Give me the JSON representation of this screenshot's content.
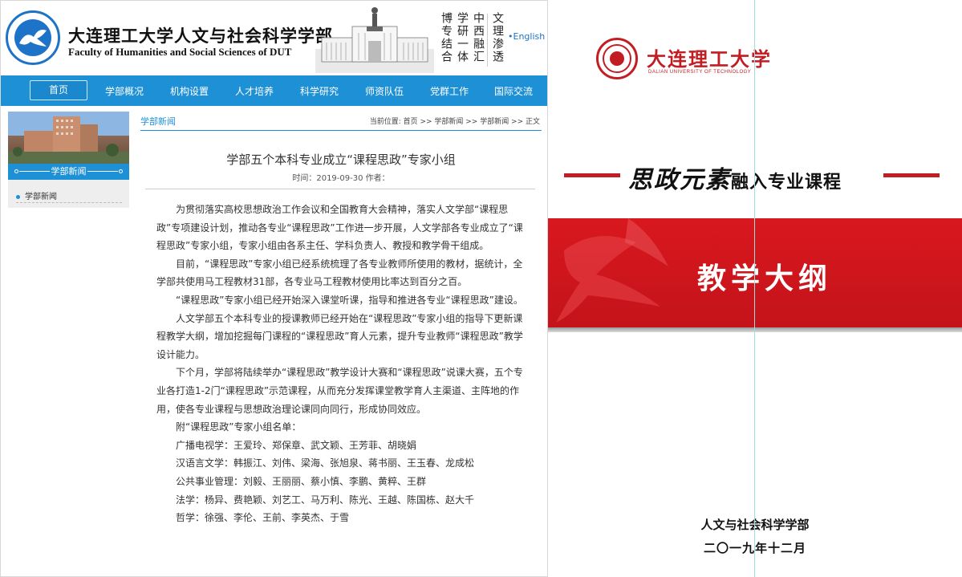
{
  "header": {
    "title_cn": "大连理工大学人文与社会科学学部",
    "title_en": "Faculty of Humanities and Social Sciences of DUT",
    "motto_columns": [
      "博专结合",
      "学研一体",
      "中西融汇",
      "文理渗透"
    ],
    "english_link": "•English"
  },
  "nav": {
    "items": [
      "首页",
      "学部概况",
      "机构设置",
      "人才培养",
      "科学研究",
      "师资队伍",
      "党群工作",
      "国际交流"
    ]
  },
  "sidebar": {
    "title": "学部新闻",
    "items": [
      "学部新闻"
    ]
  },
  "content": {
    "section": "学部新闻",
    "breadcrumb": "当前位置:  首页  >> 学部新闻  >>  学部新闻  >>  正文"
  },
  "article": {
    "title": "学部五个本科专业成立“课程思政”专家小组",
    "meta": "时间：2019-09-30 作者：",
    "paragraphs": [
      "为贯彻落实高校思想政治工作会议和全国教育大会精神，落实人文学部“课程思政”专项建设计划，推动各专业“课程思政”工作进一步开展，人文学部各专业成立了“课程思政”专家小组，专家小组由各系主任、学科负责人、教授和教学骨干组成。",
      "目前，“课程思政”专家小组已经系统梳理了各专业教师所使用的教材，据统计，全学部共使用马工程教材31部，各专业马工程教材使用比率达到百分之百。",
      "“课程思政”专家小组已经开始深入课堂听课，指导和推进各专业“课程思政”建设。",
      "人文学部五个本科专业的授课教师已经开始在“课程思政”专家小组的指导下更新课程教学大纲，增加挖掘每门课程的“课程思政”育人元素，提升专业教师“课程思政”教学设计能力。",
      "下个月，学部将陆续举办“课程思政”教学设计大赛和“课程思政”说课大赛，五个专业各打造1-2门“课程思政”示范课程，从而充分发挥课堂教学育人主渠道、主阵地的作用，使各专业课程与思想政治理论课同向同行，形成协同效应。",
      "附“课程思政”专家小组名单："
    ],
    "members": [
      "广播电视学：王爱玲、郑保章、武文颖、王芳菲、胡晓娟",
      "汉语言文学：韩振江、刘伟、梁海、张旭泉、蒋书丽、王玉春、龙成松",
      "公共事业管理：刘毅、王丽丽、蔡小慎、李鹏、黄粹、王群",
      "法学：杨异、费艳颖、刘艺工、马万利、陈光、王越、陈国栋、赵大千",
      "哲学：徐强、李伦、王前、李英杰、于雪"
    ]
  },
  "cover": {
    "university_cn": "大连理工大学",
    "university_en": "DALIAN UNIVERSITY OF TECHNOLOGY",
    "subtitle_callig": "思政元素",
    "subtitle_plain": "融入专业课程",
    "main_title": "教学大纲",
    "department": "人文与社会科学学部",
    "date": "二〇一九年十二月"
  },
  "colors": {
    "nav_blue": "#1e90d6",
    "logo_blue": "#1d73c8",
    "cover_red": "#c21d22",
    "band_red": "#d8181e"
  }
}
